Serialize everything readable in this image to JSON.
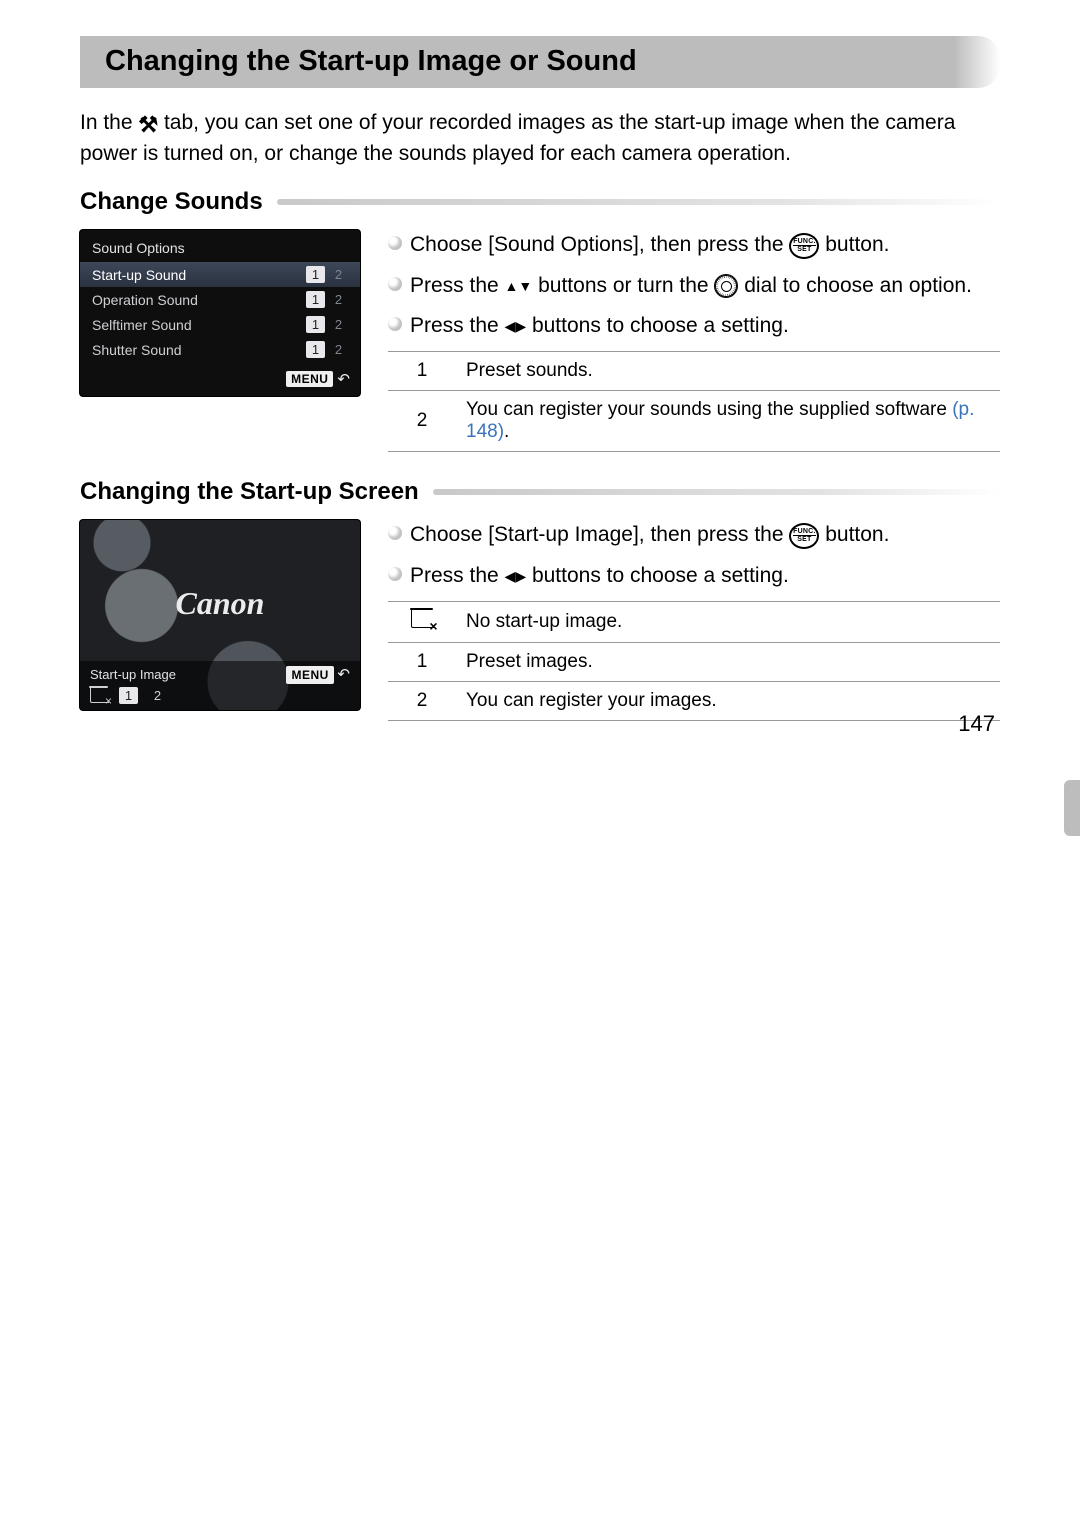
{
  "page_number": "147",
  "title": "Changing the Start-up Image or Sound",
  "intro_parts": {
    "before": "In the ",
    "after": " tab, you can set one of your recorded images as the start-up image when the camera power is turned on, or change the sounds played for each camera operation."
  },
  "sections": {
    "sounds": {
      "heading": "Change Sounds",
      "lcd": {
        "title": "Sound Options",
        "rows": [
          {
            "label": "Start-up Sound",
            "v1": "1",
            "v2": "2",
            "selected": true,
            "active": "1"
          },
          {
            "label": "Operation Sound",
            "v1": "1",
            "v2": "2",
            "selected": false,
            "active": "1"
          },
          {
            "label": "Selftimer Sound",
            "v1": "1",
            "v2": "2",
            "selected": false,
            "active": "1"
          },
          {
            "label": "Shutter Sound",
            "v1": "1",
            "v2": "2",
            "selected": false,
            "active": "1"
          }
        ],
        "menu_label": "MENU"
      },
      "bullets": {
        "b1a": "Choose [Sound Options], then press the ",
        "b1b": " button.",
        "b2a": "Press the ",
        "b2b": " buttons or turn the ",
        "b2c": " dial to choose an option.",
        "b3a": "Press the ",
        "b3b": " buttons to choose a setting."
      },
      "table": [
        {
          "k": "1",
          "v": "Preset sounds."
        },
        {
          "k": "2",
          "v": "You can register your sounds using the supplied software ",
          "link": "(p. 148)",
          "after": "."
        }
      ]
    },
    "startup": {
      "heading": "Changing the Start-up Screen",
      "lcd": {
        "brand": "Canon",
        "label": "Start-up Image",
        "menu_label": "MENU",
        "opts": {
          "i1": "1",
          "i2": "2"
        }
      },
      "bullets": {
        "b1a": "Choose [Start-up Image], then press the ",
        "b1b": " button.",
        "b2a": "Press the ",
        "b2b": " buttons to choose a setting."
      },
      "table": [
        {
          "k": "noimg",
          "v": "No start-up image."
        },
        {
          "k": "1",
          "v": "Preset images."
        },
        {
          "k": "2",
          "v": "You can register your images."
        }
      ]
    }
  }
}
